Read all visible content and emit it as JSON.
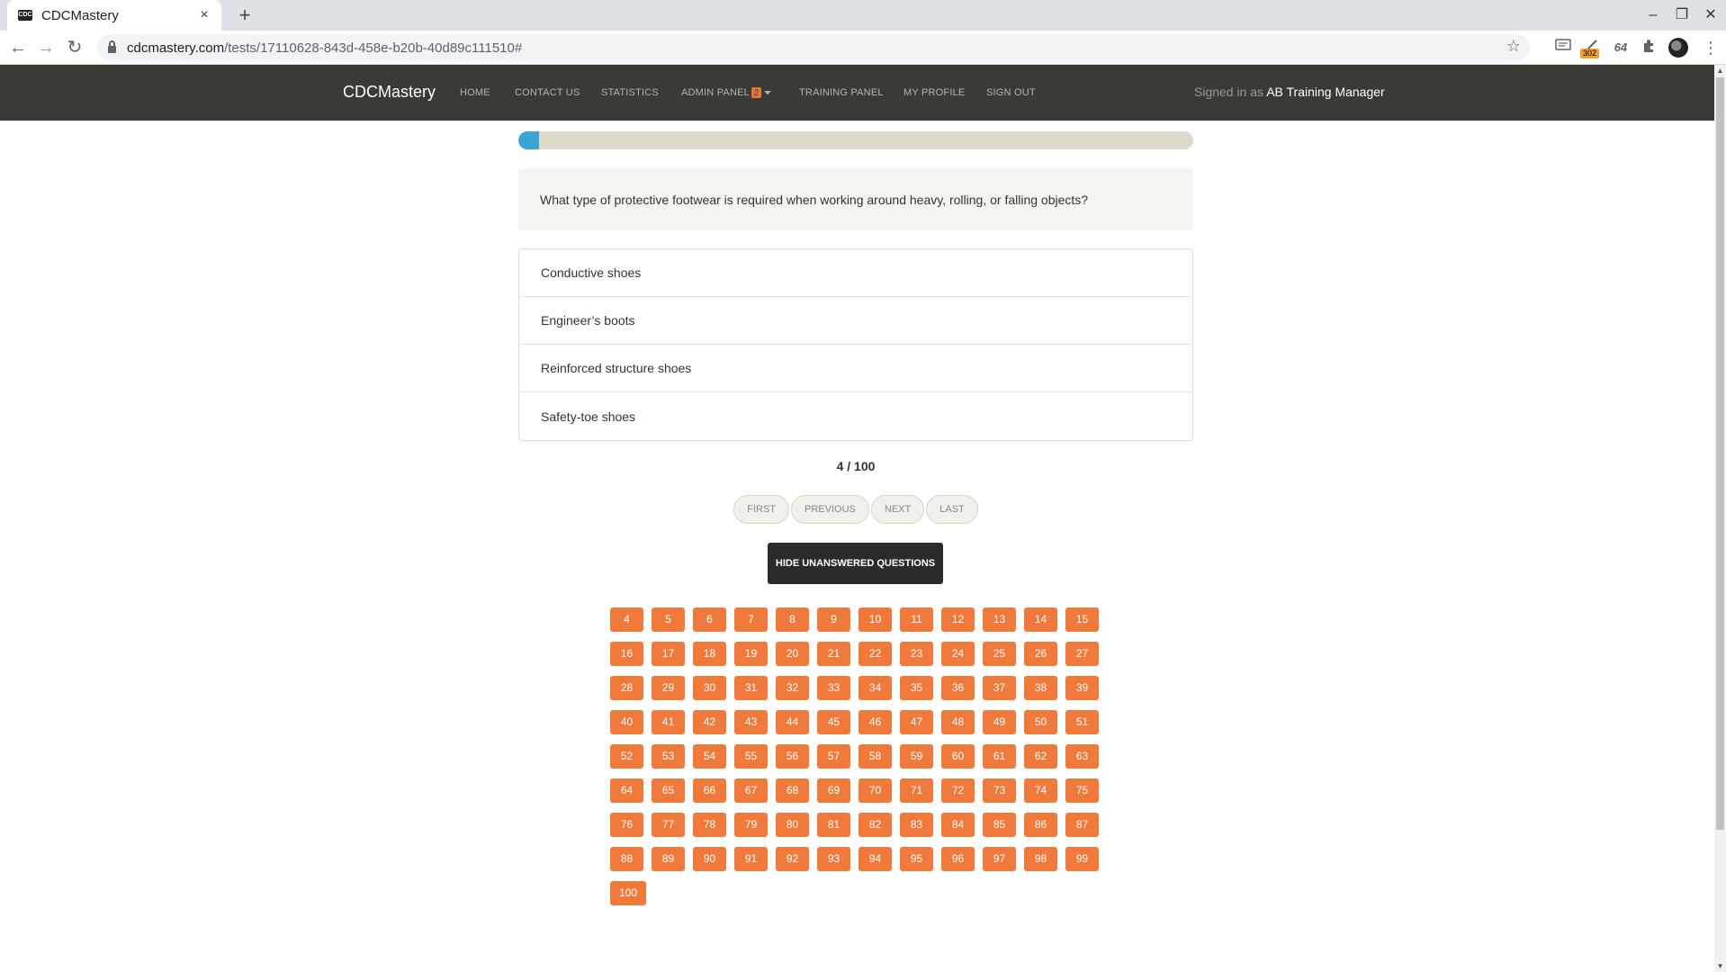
{
  "browser": {
    "tab_title": "CDCMastery",
    "favicon_text": "CDC",
    "tab_close": "×",
    "new_tab": "+",
    "url_host": "cdcmastery.com",
    "url_path": "/tests/17110628-843d-458e-b20b-40d89c111510#",
    "ext_badge": "302",
    "ext_label": "64",
    "back": "←",
    "forward": "→",
    "reload": "↻",
    "star": "☆",
    "minimize": "–",
    "restore": "❐",
    "close": "✕",
    "menu": "⋮"
  },
  "navbar": {
    "brand": "CDCMastery",
    "links": {
      "home": "HOME",
      "contact": "CONTACT US",
      "statistics": "STATISTICS",
      "admin": "ADMIN PANEL",
      "admin_badge": "2",
      "training": "TRAINING PANEL",
      "profile": "MY PROFILE",
      "signout": "SIGN OUT"
    },
    "signed_in_prefix": "Signed in as",
    "signed_in_user": "AB Training Manager"
  },
  "test": {
    "progress_fraction": 0.03,
    "question": "What type of protective footwear is required when working around heavy, rolling, or falling objects?",
    "answers": [
      "Conductive shoes",
      "Engineer’s boots",
      "Reinforced structure shoes",
      "Safety-toe shoes"
    ],
    "counter": "4 / 100",
    "pager": {
      "first": "FIRST",
      "previous": "PREVIOUS",
      "next": "NEXT",
      "last": "LAST"
    },
    "hide_button": "HIDE UNANSWERED QUESTIONS",
    "question_numbers": [
      "4",
      "5",
      "6",
      "7",
      "8",
      "9",
      "10",
      "11",
      "12",
      "13",
      "14",
      "15",
      "16",
      "17",
      "18",
      "19",
      "20",
      "21",
      "22",
      "23",
      "24",
      "25",
      "26",
      "27",
      "28",
      "29",
      "30",
      "31",
      "32",
      "33",
      "34",
      "35",
      "36",
      "37",
      "38",
      "39",
      "40",
      "41",
      "42",
      "43",
      "44",
      "45",
      "46",
      "47",
      "48",
      "49",
      "50",
      "51",
      "52",
      "53",
      "54",
      "55",
      "56",
      "57",
      "58",
      "59",
      "60",
      "61",
      "62",
      "63",
      "64",
      "65",
      "66",
      "67",
      "68",
      "69",
      "70",
      "71",
      "72",
      "73",
      "74",
      "75",
      "76",
      "77",
      "78",
      "79",
      "80",
      "81",
      "82",
      "83",
      "84",
      "85",
      "86",
      "87",
      "88",
      "89",
      "90",
      "91",
      "92",
      "93",
      "94",
      "95",
      "96",
      "97",
      "98",
      "99",
      "100"
    ]
  },
  "colors": {
    "navbar_bg": "#3b3b36",
    "accent_orange": "#f07a3c",
    "progress_blue": "#3ba3d8",
    "progress_track": "#dfd9cc"
  }
}
